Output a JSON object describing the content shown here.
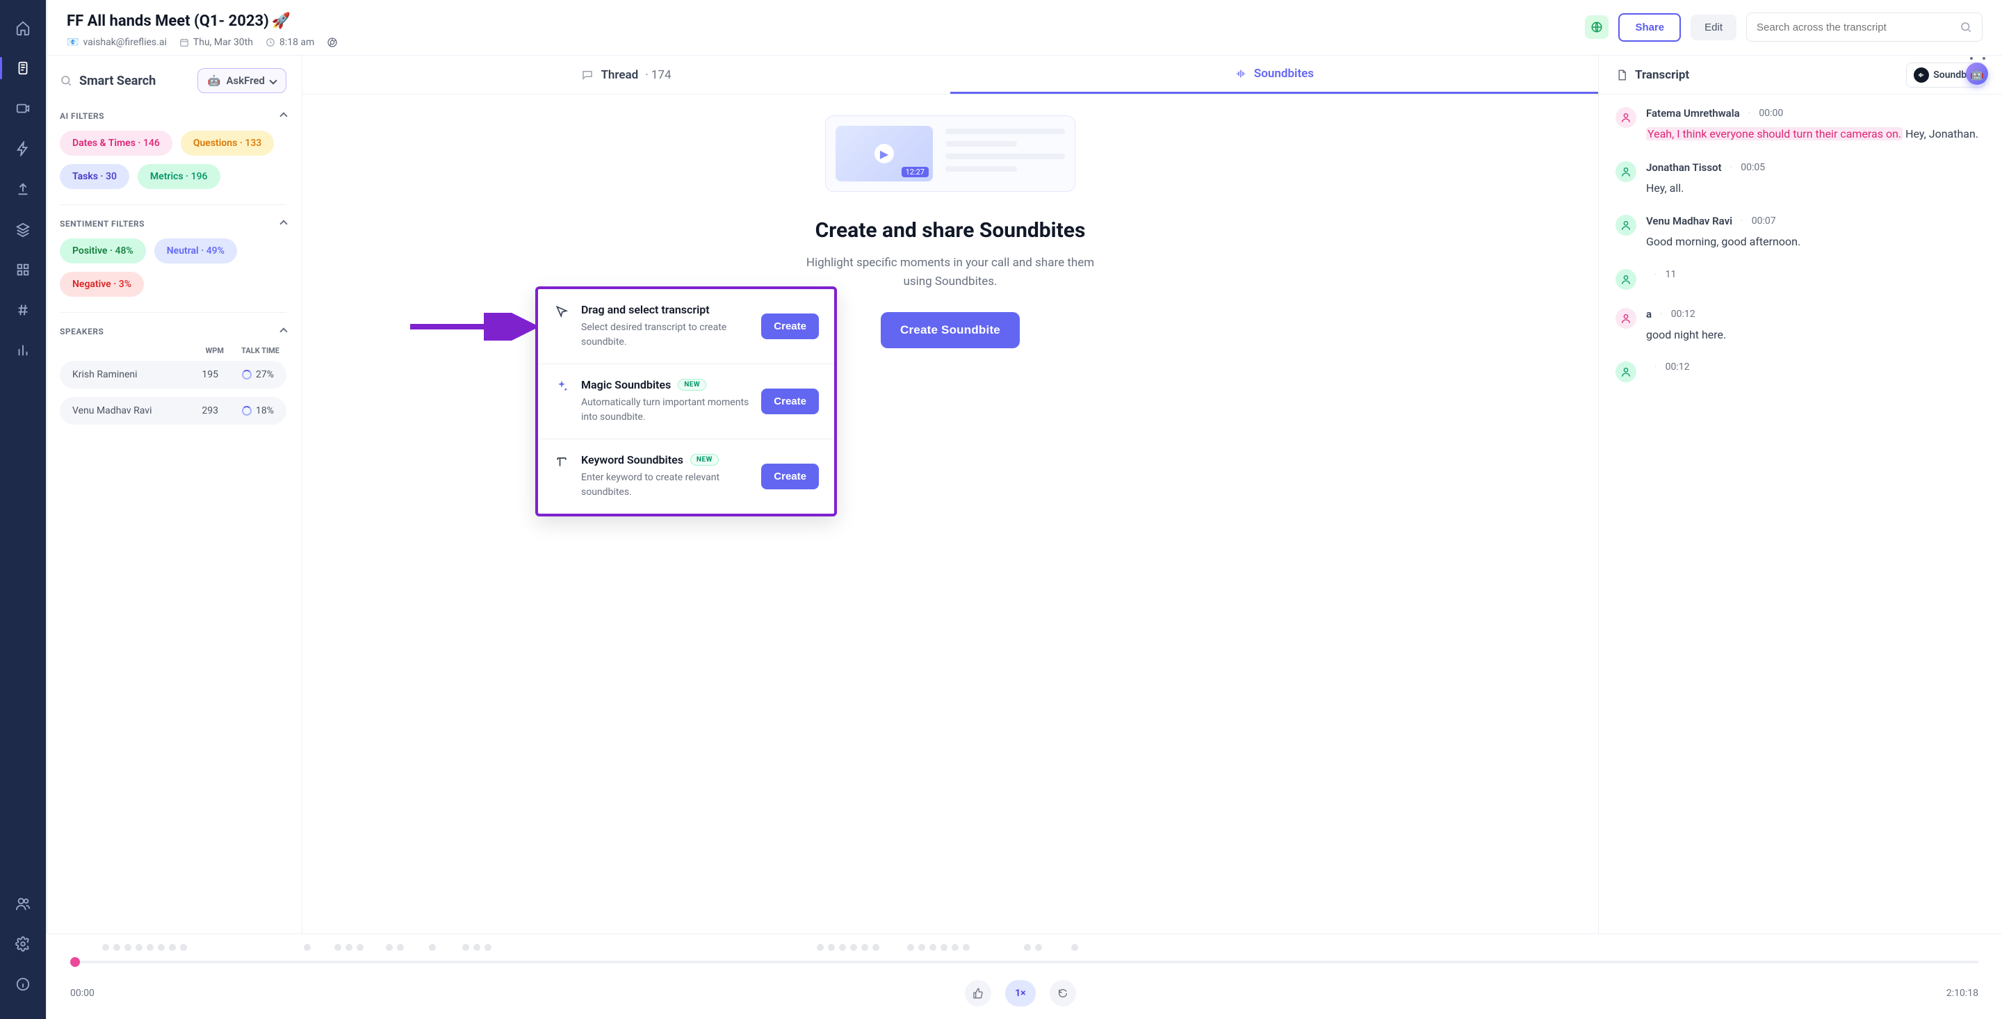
{
  "header": {
    "title": "FF All hands Meet (Q1- 2023)",
    "title_emoji": "🚀",
    "email": "vaishak@fireflies.ai",
    "date": "Thu, Mar 30th",
    "time": "8:18 am",
    "share_label": "Share",
    "edit_label": "Edit",
    "search_placeholder": "Search across the transcript"
  },
  "left": {
    "smart_search_label": "Smart Search",
    "ask_fred_label": "AskFred",
    "ai_filters_label": "AI FILTERS",
    "filters": [
      {
        "label": "Dates & Times",
        "count": "146",
        "style": "pink"
      },
      {
        "label": "Questions",
        "count": "133",
        "style": "orange"
      },
      {
        "label": "Tasks",
        "count": "30",
        "style": "blue"
      },
      {
        "label": "Metrics",
        "count": "196",
        "style": "teal"
      }
    ],
    "sentiment_label": "SENTIMENT FILTERS",
    "sentiments": [
      {
        "label": "Positive",
        "count": "48%",
        "style": "green"
      },
      {
        "label": "Neutral",
        "count": "49%",
        "style": "violet"
      },
      {
        "label": "Negative",
        "count": "3%",
        "style": "red"
      }
    ],
    "speakers_label": "SPEAKERS",
    "wpm_hdr": "WPM",
    "talk_hdr": "TALK TIME",
    "speakers": [
      {
        "name": "Krish Ramineni",
        "wpm": "195",
        "talk": "27%"
      },
      {
        "name": "Venu Madhav Ravi",
        "wpm": "293",
        "talk": "18%"
      }
    ]
  },
  "mid": {
    "thread_label": "Thread",
    "thread_count": "174",
    "soundbites_label": "Soundbites",
    "placeholder_time": "12:27",
    "panel_title": "Create and share Soundbites",
    "panel_desc": "Highlight specific moments in your call and share them using Soundbites.",
    "panel_btn": "Create Soundbite"
  },
  "right": {
    "transcript_label": "Transcript",
    "chip_label": "Soundbite",
    "entries": [
      {
        "avatar": "av-pink",
        "name": "Fatema Umrethwala",
        "time": "00:00",
        "hl": "Yeah, I think everyone should turn their cameras on.",
        "rest": " Hey, Jonathan."
      },
      {
        "avatar": "av-green",
        "name": "Jonathan Tissot",
        "time": "00:05",
        "hl": "",
        "rest": "Hey, all."
      },
      {
        "avatar": "av-green",
        "name": "Venu Madhav Ravi",
        "time": "00:07",
        "hl": "",
        "rest": "Good morning, good afternoon."
      },
      {
        "avatar": "av-green",
        "name": "",
        "time": "11",
        "hl": "",
        "rest": ""
      },
      {
        "avatar": "av-pink",
        "name": "a",
        "time": "00:12",
        "hl": "",
        "rest": " good night here."
      },
      {
        "avatar": "av-green",
        "name": "",
        "time": "00:12",
        "hl": "",
        "rest": ""
      }
    ]
  },
  "footer": {
    "start": "00:00",
    "end": "2:10:18",
    "speed": "1×"
  },
  "pop": {
    "rows": [
      {
        "icon": "cursor",
        "title": "Drag and select transcript",
        "badge": "",
        "desc": "Select desired transcript to create soundbite.",
        "btn": "Create"
      },
      {
        "icon": "sparkle",
        "title": "Magic Soundbites",
        "badge": "NEW",
        "desc": "Automatically turn important moments into soundbite.",
        "btn": "Create"
      },
      {
        "icon": "text",
        "title": "Keyword Soundbites",
        "badge": "NEW",
        "desc": "Enter keyword to create relevant soundbites.",
        "btn": "Create"
      }
    ]
  }
}
